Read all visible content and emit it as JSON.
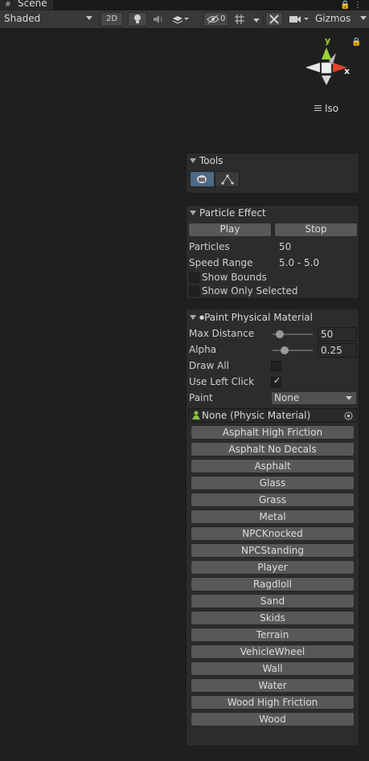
{
  "tab": {
    "title": "Scene"
  },
  "toolbar": {
    "shading_mode": "Shaded",
    "mode_2d": "2D",
    "hidden_count": "0",
    "gizmos_label": "Gizmos"
  },
  "gizmo": {
    "x_label": "x",
    "y_label": "y",
    "projection_label": "Iso"
  },
  "tools_panel": {
    "title": "Tools"
  },
  "particle_panel": {
    "title": "Particle Effect",
    "play_label": "Play",
    "stop_label": "Stop",
    "particles_label": "Particles",
    "particles_value": "50",
    "speed_label": "Speed Range",
    "speed_value": "5.0 - 5.0",
    "show_bounds_label": "Show Bounds",
    "show_bounds_checked": false,
    "show_only_selected_label": "Show Only Selected",
    "show_only_selected_checked": false
  },
  "paint_panel": {
    "title": "Paint Physical Material",
    "max_distance_label": "Max Distance",
    "max_distance_value": "50",
    "max_distance_fraction": 0.1,
    "alpha_label": "Alpha",
    "alpha_value": "0.25",
    "alpha_fraction": 0.25,
    "draw_all_label": "Draw All",
    "draw_all_checked": false,
    "use_left_click_label": "Use Left Click",
    "use_left_click_checked": true,
    "paint_label": "Paint",
    "paint_value": "None",
    "material_field": "None (Physic Material)",
    "materials": [
      "Asphalt High Friction",
      "Asphalt No Decals",
      "Asphalt",
      "Glass",
      "Grass",
      "Metal",
      "NPCKnocked",
      "NPCStanding",
      "Player",
      "Ragdloll",
      "Sand",
      "Skids",
      "Terrain",
      "VehicleWheel",
      "Wall",
      "Water",
      "Wood High Friction",
      "Wood"
    ]
  },
  "colors": {
    "axis_x": "#e0432f",
    "axis_y": "#9ad431",
    "background": "#1f1f1f",
    "panel": "#2c2c2c",
    "button": "#585858"
  }
}
